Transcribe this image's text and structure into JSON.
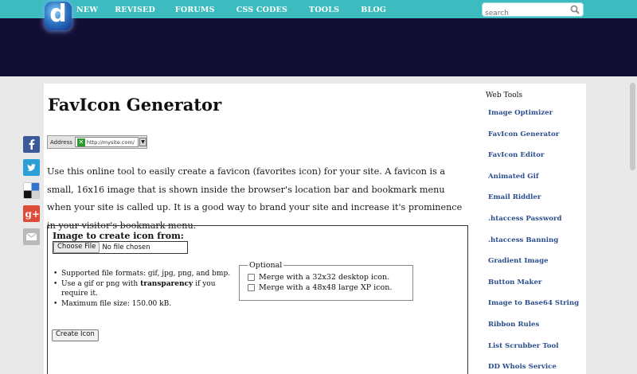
{
  "header": {
    "nav": [
      "NEW",
      "REVISED",
      "FORUMS",
      "CSS CODES",
      "TOOLS",
      "BLOG"
    ],
    "search_placeholder": "search",
    "logo_letter": "d"
  },
  "page": {
    "title": "FavIcon Generator",
    "address_label": "Address",
    "address_url": "http://mysite.com/",
    "description": "Use this online tool to easily create a favicon (favorites icon) for your site. A favicon is a small, 16x16 image that is shown inside the browser's location bar and bookmark menu when your site is called up. It is a good way to brand your site and increase it's prominence in your visitor's bookmark menu."
  },
  "form": {
    "heading": "Image to create icon from:",
    "choose_file_label": "Choose File",
    "file_status": "No file chosen",
    "rules": {
      "formats": "Supported file formats: gif, jpg, png, and bmp.",
      "transparency_pre": "Use a gif or png with ",
      "transparency_bold": "transparency",
      "transparency_post": " if you require it.",
      "max_size": "Maximum file size: 150.00 kB."
    },
    "optional_legend": "Optional",
    "option1": "Merge with a 32x32 desktop icon.",
    "option2": "Merge with a 48x48 large XP icon.",
    "create_label": "Create Icon"
  },
  "social": [
    "facebook-icon",
    "twitter-icon",
    "delicious-icon",
    "google-plus-icon",
    "email-icon"
  ],
  "sidebar": {
    "title": "Web Tools",
    "items": [
      "Image Optimizer",
      "FavIcon Generator",
      "FavIcon Editor",
      "Animated Gif",
      "Email Riddler",
      ".htaccess Password",
      ".htaccess Banning",
      "Gradient Image",
      "Button Maker",
      "Image to Base64 String",
      "Ribbon Rules",
      "List Scrubber Tool",
      "DD Whois Service"
    ]
  },
  "colors": {
    "nav_bar": "#3cbcbf",
    "banner": "#130e33",
    "link": "#2b4e8c"
  }
}
